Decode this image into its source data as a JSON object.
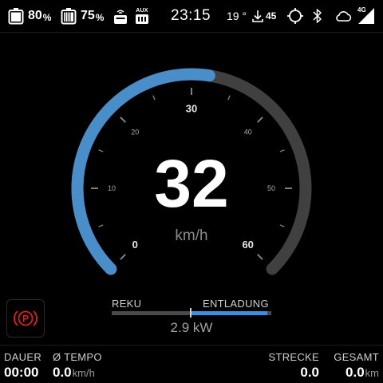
{
  "status": {
    "battery_primary": {
      "value": "80",
      "unit": "%"
    },
    "battery_secondary": {
      "value": "75",
      "unit": "%"
    },
    "aux_label": "AUX",
    "clock": "23:15",
    "temperature": "19 °",
    "download_count": "45",
    "network_label": "4G",
    "icons": [
      "battery-icon",
      "battery-icon",
      "radio-icon",
      "aux-icon",
      "download-icon",
      "gps-icon",
      "bluetooth-icon",
      "cloud-icon",
      "signal-icon"
    ]
  },
  "gauge": {
    "speed": "32",
    "unit": "km/h",
    "min": 0,
    "max": 60,
    "current": 32,
    "tick_labels": [
      "0",
      "10",
      "20",
      "30",
      "40",
      "50",
      "60"
    ],
    "colors": {
      "active": "#4a8ec9",
      "track": "#404040"
    }
  },
  "power": {
    "left_label": "REKU",
    "right_label": "ENTLADUNG",
    "value": "2.9 kW",
    "level_fraction": 0.95,
    "fill_color": "#3a8fe0"
  },
  "parking_brake": {
    "icon": "parking-brake-icon",
    "color": "#e0201c"
  },
  "trip": {
    "duration": {
      "label": "DAUER",
      "value": "00:00"
    },
    "avg_speed": {
      "label": "Ø TEMPO",
      "value": "0.0",
      "unit": "km/h"
    },
    "distance": {
      "label": "STRECKE",
      "value": "0.0"
    },
    "total": {
      "label": "GESAMT",
      "value": "0.0",
      "unit": "km"
    }
  }
}
